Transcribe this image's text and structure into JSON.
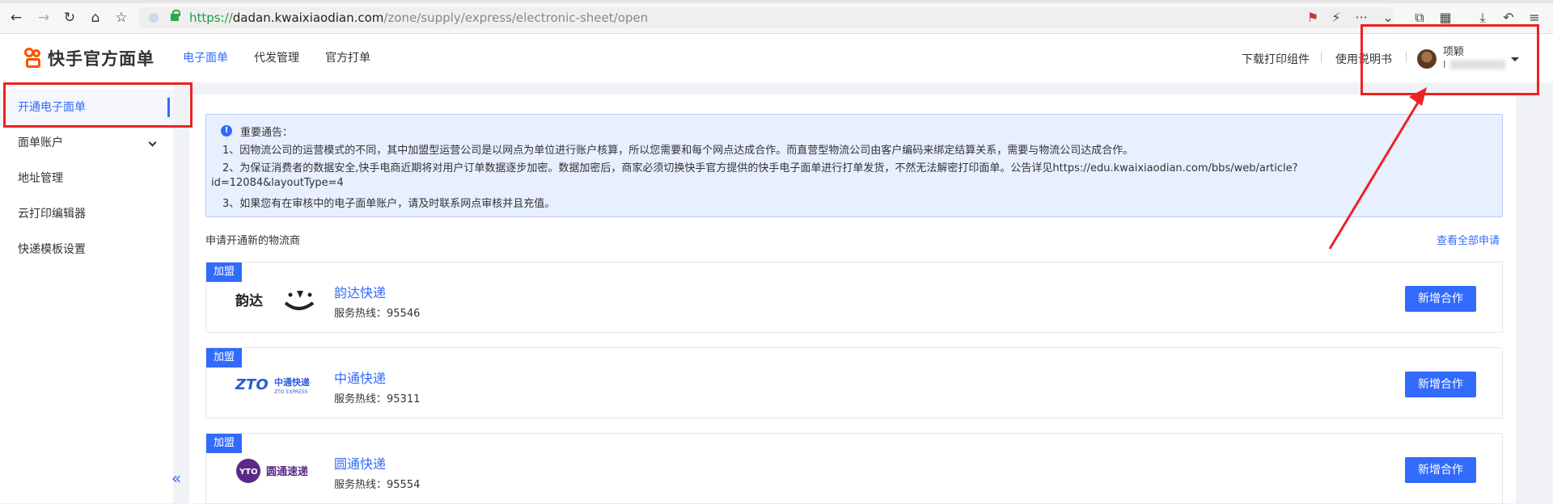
{
  "browser": {
    "url_scheme": "https://",
    "url_host": "dadan.kwaixiaodian.com",
    "url_path": "/zone/supply/express/electronic-sheet/open",
    "back_icon": "←",
    "forward_icon": "→",
    "reload_icon": "↻",
    "home_icon": "⌂",
    "star_icon": "☆",
    "ext_icons": [
      "⚑",
      "⚡",
      "···",
      "⌄",
      "⧉",
      "▦",
      "⤓",
      "↶",
      "≡"
    ]
  },
  "app": {
    "logo_text": "快手官方面单",
    "nav": [
      {
        "label": "电子面单",
        "active": true
      },
      {
        "label": "代发管理",
        "active": false
      },
      {
        "label": "官方打单",
        "active": false
      }
    ],
    "header_links": [
      "下载打印组件",
      "使用说明书"
    ],
    "user_name": "项颖",
    "user_sub": "I"
  },
  "sidebar": {
    "items": [
      {
        "label": "开通电子面单",
        "active": true
      },
      {
        "label": "面单账户",
        "active": false
      },
      {
        "label": "地址管理",
        "active": false
      },
      {
        "label": "云打印编辑器",
        "active": false
      },
      {
        "label": "快递模板设置",
        "active": false
      }
    ],
    "collapse_icon": "«"
  },
  "notice": {
    "icon": "!",
    "title": "重要通告：",
    "lines": [
      "1、因物流公司的运营模式的不同，其中加盟型运营公司是以网点为单位进行账户核算，所以您需要和每个网点达成合作。而直营型物流公司由客户编码来绑定结算关系，需要与物流公司达成合作。",
      "2、为保证消费者的数据安全,快手电商近期将对用户订单数据逐步加密。数据加密后，商家必须切换快手官方提供的快手电子面单进行打单发货，不然无法解密打印面单。公告详见https://edu.kwaixiaodian.com/bbs/web/article?",
      "id=12084&layoutType=4",
      "3、如果您有在审核中的电子面单账户，请及时联系网点审核并且充值。"
    ]
  },
  "section": {
    "title": "申请开通新的物流商",
    "view_all": "查看全部申请"
  },
  "carriers": [
    {
      "badge": "加盟",
      "name": "韵达快递",
      "hotline": "服务热线：95546",
      "button": "新增合作",
      "logo": "韵达"
    },
    {
      "badge": "加盟",
      "name": "中通快递",
      "hotline": "服务热线：95311",
      "button": "新增合作",
      "logo": "ZTO中通快递"
    },
    {
      "badge": "加盟",
      "name": "圆通快递",
      "hotline": "服务热线：95554",
      "button": "新增合作",
      "logo": "圆通速递"
    }
  ],
  "colors": {
    "accent": "#326bfb",
    "annotation_red": "#ee2222",
    "brand_orange": "#ff5000"
  }
}
